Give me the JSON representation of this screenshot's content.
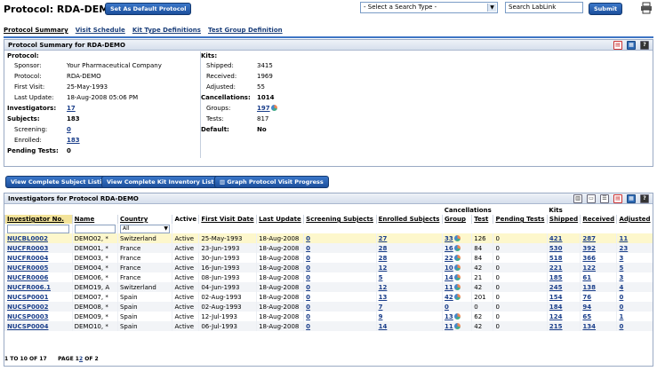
{
  "header": {
    "title": "Protocol: RDA-DEMO",
    "set_default_button": "Set As Default Protocol",
    "search_type_placeholder": "- Select a Search Type -",
    "search_input_value": "Search LabLink",
    "submit_button": "Submit"
  },
  "tabs": [
    "Protocol Summary",
    "Visit Schedule",
    "Kit Type Definitions",
    "Test Group Definition"
  ],
  "summary": {
    "header": "Protocol Summary for RDA-DEMO",
    "protocol_label": "Protocol:",
    "sponsor_label": "Sponsor:",
    "sponsor": "Your Pharmaceutical Company",
    "protocol2_label": "Protocol:",
    "protocol": "RDA-DEMO",
    "first_visit_label": "First Visit:",
    "first_visit": "25-May-1993",
    "last_update_label": "Last Update:",
    "last_update": "18-Aug-2008 05:06 PM",
    "investigators_label": "Investigators:",
    "investigators": "17",
    "subjects_label": "Subjects:",
    "subjects": "183",
    "screening_label": "Screening:",
    "screening": "0",
    "enrolled_label": "Enrolled:",
    "enrolled": "183",
    "pending_label": "Pending Tests:",
    "pending": "0",
    "kits_label": "Kits:",
    "shipped_label": "Shipped:",
    "shipped": "3415",
    "received_label": "Received:",
    "received": "1969",
    "adjusted_label": "Adjusted:",
    "adjusted": "55",
    "cancellations_label": "Cancellations:",
    "cancellations": "1014",
    "groups_label": "Groups:",
    "groups": "197",
    "tests_label": "Tests:",
    "tests": "817",
    "default_label": "Default:",
    "default": "No"
  },
  "actions": {
    "subject_listing": "View Complete Subject Listing",
    "kit_inventory": "View Complete Kit Inventory Listing",
    "graph": "Graph Protocol Visit Progress"
  },
  "investigators": {
    "header": "Investigators for Protocol RDA-DEMO",
    "group_header_cancellations": "Cancellations",
    "group_header_kits": "Kits",
    "columns": [
      "Investigator No.",
      "Name",
      "Country",
      "Active",
      "First Visit Date",
      "Last Update",
      "Screening Subjects",
      "Enrolled Subjects",
      "Group",
      "Test",
      "Pending Tests",
      "Shipped",
      "Received",
      "Adjusted"
    ],
    "country_filter": "All",
    "rows": [
      [
        "NUCBL0002",
        "DEMO02, *",
        "Switzerland",
        "Active",
        "25-May-1993",
        "18-Aug-2008",
        "0",
        "27",
        "33",
        "126",
        "0",
        "421",
        "287",
        "11"
      ],
      [
        "NUCFR0003",
        "DEMO01, *",
        "France",
        "Active",
        "23-Jun-1993",
        "18-Aug-2008",
        "0",
        "28",
        "16",
        "84",
        "0",
        "530",
        "392",
        "23"
      ],
      [
        "NUCFR0004",
        "DEMO03, *",
        "France",
        "Active",
        "30-Jun-1993",
        "18-Aug-2008",
        "0",
        "28",
        "22",
        "84",
        "0",
        "518",
        "366",
        "3"
      ],
      [
        "NUCFR0005",
        "DEMO04, *",
        "France",
        "Active",
        "16-Jun-1993",
        "18-Aug-2008",
        "0",
        "12",
        "10",
        "42",
        "0",
        "221",
        "122",
        "5"
      ],
      [
        "NUCFR0006",
        "DEMO06, *",
        "France",
        "Active",
        "08-Jun-1993",
        "18-Aug-2008",
        "0",
        "5",
        "14",
        "21",
        "0",
        "185",
        "61",
        "3"
      ],
      [
        "NUCFR006.1",
        "DEMO19, A",
        "Switzerland",
        "Active",
        "04-Jun-1993",
        "18-Aug-2008",
        "0",
        "12",
        "11",
        "42",
        "0",
        "245",
        "138",
        "4"
      ],
      [
        "NUCSP0001",
        "DEMO07, *",
        "Spain",
        "Active",
        "02-Aug-1993",
        "18-Aug-2008",
        "0",
        "13",
        "42",
        "201",
        "0",
        "154",
        "76",
        "0"
      ],
      [
        "NUCSP0002",
        "DEMO08, *",
        "Spain",
        "Active",
        "02-Aug-1993",
        "18-Aug-2008",
        "0",
        "7",
        "0",
        "0",
        "0",
        "184",
        "94",
        "0"
      ],
      [
        "NUCSP0003",
        "DEMO09, *",
        "Spain",
        "Active",
        "12-Jul-1993",
        "18-Aug-2008",
        "0",
        "9",
        "13",
        "62",
        "0",
        "124",
        "65",
        "1"
      ],
      [
        "NUCSP0004",
        "DEMO10, *",
        "Spain",
        "Active",
        "06-Jul-1993",
        "18-Aug-2008",
        "0",
        "14",
        "11",
        "42",
        "0",
        "215",
        "134",
        "0"
      ]
    ],
    "footer_range": "1 TO 10 OF 17",
    "footer_page_label": "PAGE",
    "footer_page_1": "1",
    "footer_page_2": "2",
    "footer_of": "OF 2"
  },
  "colors": {
    "accent": "#1c4f9c",
    "link": "#1a3e8a",
    "highlight_row": "#fdf7cc"
  }
}
